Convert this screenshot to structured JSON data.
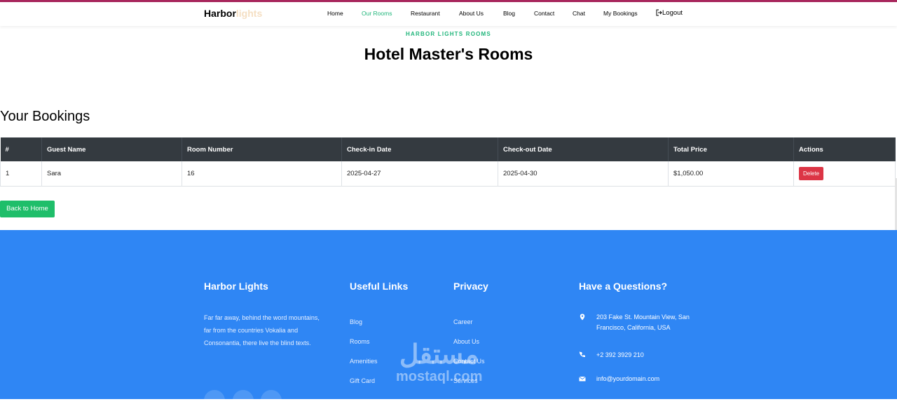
{
  "brand": {
    "dark": "Harbor",
    "light": "lights"
  },
  "nav": {
    "items": [
      "Home",
      "Our Rooms",
      "Restaurant",
      "About Us",
      "Blog",
      "Contact",
      "Chat",
      "My Bookings"
    ],
    "logout": "Logout",
    "active": "Our Rooms"
  },
  "hero": {
    "subtitle": "HARBOR LIGHTS ROOMS",
    "title": "Hotel Master's Rooms"
  },
  "bookings": {
    "title": "Your Bookings",
    "columns": [
      "#",
      "Guest Name",
      "Room Number",
      "Check-in Date",
      "Check-out Date",
      "Total Price",
      "Actions"
    ],
    "rows": [
      {
        "num": "1",
        "guest": "Sara",
        "room": "16",
        "checkin": "2025-04-27",
        "checkout": "2025-04-30",
        "price": "$1,050.00",
        "action": "Delete"
      }
    ],
    "back_label": "Back to Home"
  },
  "footer": {
    "about": {
      "title": "Harbor Lights",
      "text": "Far far away, behind the word mountains, far from the countries Vokalia and Consonantia, there live the blind texts."
    },
    "useful": {
      "title": "Useful Links",
      "links": [
        "Blog",
        "Rooms",
        "Amenities",
        "Gift Card"
      ]
    },
    "privacy": {
      "title": "Privacy",
      "links": [
        "Career",
        "About Us",
        "Contact Us",
        "Services"
      ]
    },
    "contact": {
      "title": "Have a Questions?",
      "address": "203 Fake St. Mountain View, San Francisco, California, USA",
      "phone": "+2 392 3929 210",
      "email": "info@yourdomain.com"
    },
    "watermark": {
      "ar": "مستقل",
      "en": "mostaql.com"
    }
  },
  "colors": {
    "accent_green": "#1fb57a",
    "footer_blue": "#2f86f4",
    "delete_red": "#dc3545",
    "table_head": "#343a40",
    "top_line": "#a8265c"
  }
}
